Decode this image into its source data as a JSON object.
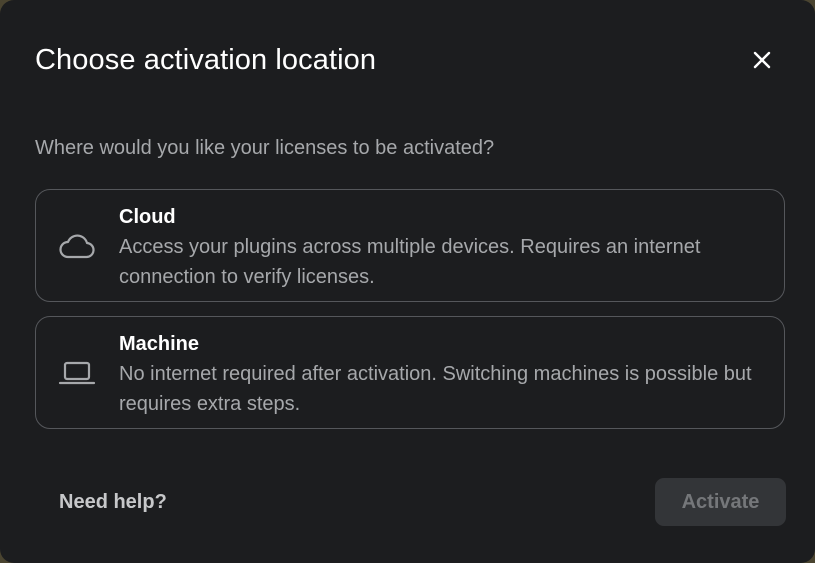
{
  "dialog": {
    "title": "Choose activation location",
    "subtitle": "Where would you like your licenses to be activated?",
    "options": [
      {
        "title": "Cloud",
        "description": "Access your plugins across multiple devices. Requires an internet connection to verify licenses.",
        "icon": "cloud-icon"
      },
      {
        "title": "Machine",
        "description": "No internet required after activation. Switching machines is possible but requires extra steps.",
        "icon": "laptop-icon"
      }
    ],
    "help_label": "Need help?",
    "activate_label": "Activate",
    "activate_disabled": true
  },
  "colors": {
    "background": "#1c1d1f",
    "border": "#55575b",
    "text_primary": "#ffffff",
    "text_secondary": "#a6a8ab",
    "button_disabled_bg": "#333538",
    "button_disabled_text": "#75777a"
  }
}
